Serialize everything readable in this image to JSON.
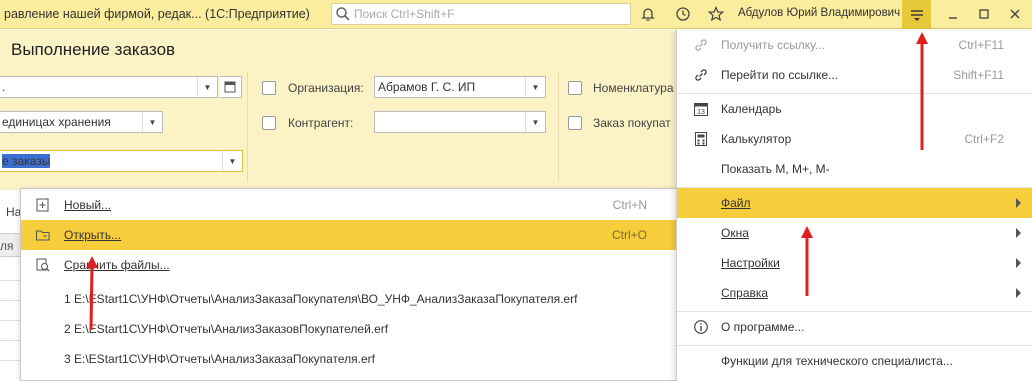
{
  "titlebar": {
    "title": "равление нашей фирмой, редак...   (1С:Предприятие)",
    "search_placeholder": "Поиск Ctrl+Shift+F",
    "user": "Абдулов Юрий Владимирович"
  },
  "form": {
    "title": "Выполнение заказов",
    "period_value": ".",
    "units_value": "единицах хранения",
    "orders_filter_value": "е заказы",
    "organization_label": "Организация:",
    "organization_value": "Абрамов Г. С. ИП",
    "counterparty_label": "Контрагент:",
    "counterparty_value": "",
    "nomenclature_label": "Номенклатура",
    "customer_order_label": "Заказ покупат",
    "grid_tab_fragment": "На",
    "grid_col_fragment": "ля"
  },
  "file_popup": {
    "items": [
      {
        "label": "Новый...",
        "shortcut": "Ctrl+N",
        "icon": "new-document-icon"
      },
      {
        "label": "Открыть...",
        "shortcut": "Ctrl+O",
        "icon": "open-folder-icon"
      },
      {
        "label": "Сравнить файлы...",
        "shortcut": "",
        "icon": "compare-files-icon"
      }
    ],
    "recent_files": [
      "1 E:\\EStart1C\\УНФ\\Отчеты\\АнализЗаказаПокупателя\\ВО_УНФ_АнализЗаказаПокупателя.erf",
      "2 E:\\EStart1C\\УНФ\\Отчеты\\АнализЗаказовПокупателей.erf",
      "3 E:\\EStart1C\\УНФ\\Отчеты\\АнализЗаказаПокупателя.erf"
    ]
  },
  "main_menu": {
    "items": [
      {
        "label": "Получить ссылку...",
        "shortcut": "Ctrl+F11",
        "icon": "link-icon",
        "disabled": true
      },
      {
        "label": "Перейти по ссылке...",
        "shortcut": "Shift+F11",
        "icon": "go-link-icon"
      },
      {
        "label": "Календарь",
        "shortcut": "",
        "icon": "calendar-icon"
      },
      {
        "label": "Калькулятор",
        "shortcut": "Ctrl+F2",
        "icon": "calculator-icon"
      },
      {
        "label": "Показать M, M+, M-",
        "shortcut": "",
        "icon": ""
      },
      {
        "label": "Файл",
        "shortcut": "",
        "icon": "",
        "submenu": true
      },
      {
        "label": "Окна",
        "shortcut": "",
        "icon": "",
        "submenu": true
      },
      {
        "label": "Настройки",
        "shortcut": "",
        "icon": "",
        "submenu": true
      },
      {
        "label": "Справка",
        "shortcut": "",
        "icon": "",
        "submenu": true
      },
      {
        "label": "О программе...",
        "shortcut": "",
        "icon": "info-icon"
      },
      {
        "label": "Функции для технического специалиста...",
        "shortcut": "",
        "icon": ""
      }
    ],
    "calendar_icon_number": "13"
  },
  "colors": {
    "title_bar": "#fbed9e",
    "highlight": "#f6cd3a",
    "annotation_arrow": "#e02020"
  }
}
